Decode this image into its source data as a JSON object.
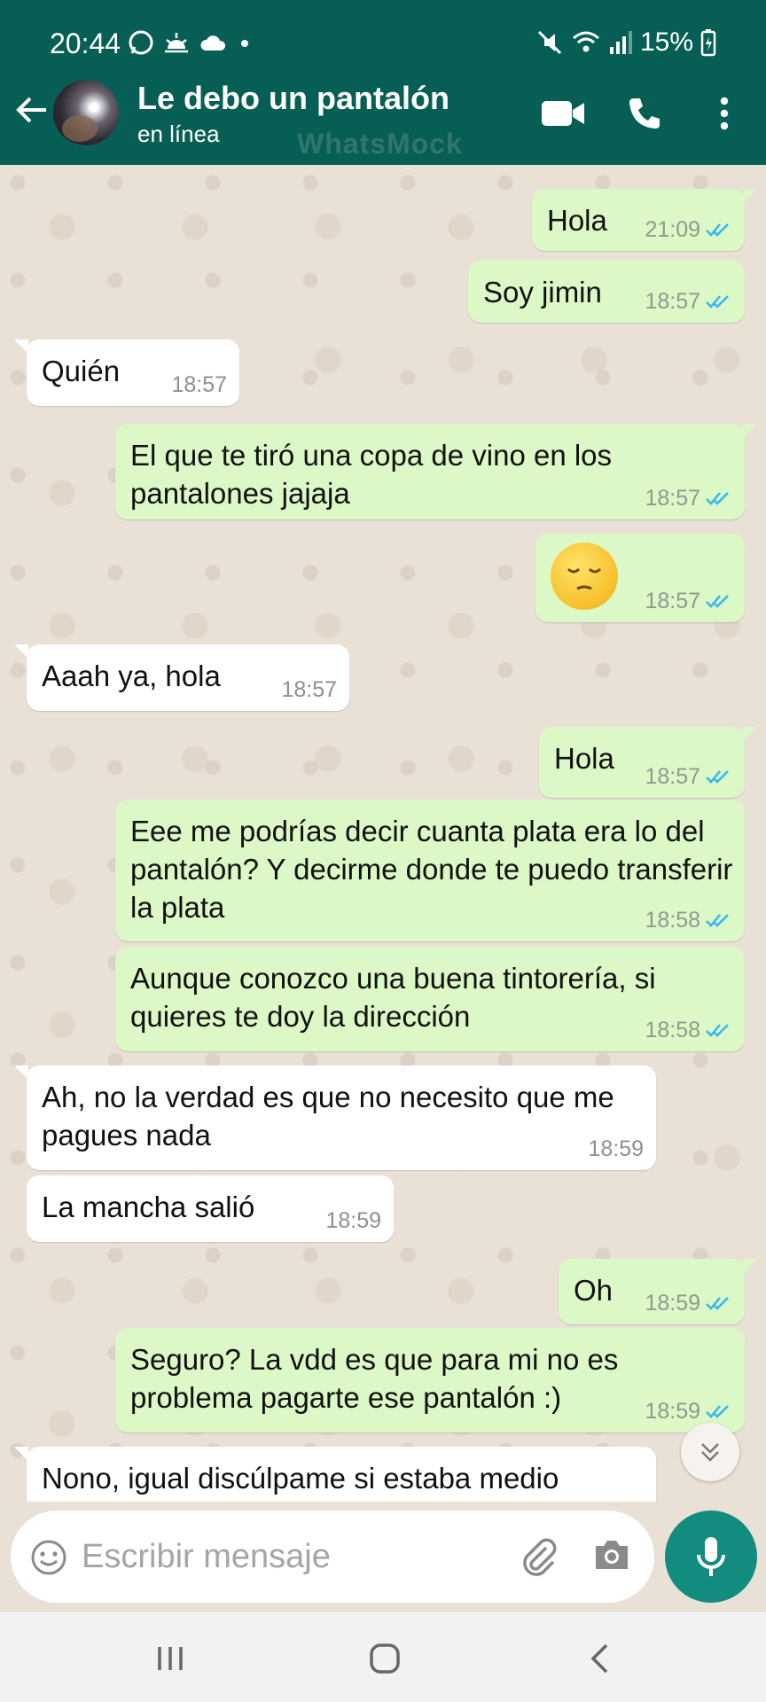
{
  "status_bar": {
    "time": "20:44",
    "battery": "15%",
    "icons": [
      "whatsapp-icon",
      "sunrise-icon",
      "cloud-icon",
      "dot-icon",
      "mute-icon",
      "wifi-icon",
      "signal-icon",
      "battery-charging-icon"
    ]
  },
  "header": {
    "contact_name": "Le debo un pantalón",
    "status": "en línea",
    "watermark": "WhatsMock",
    "icons": [
      "back-arrow-icon",
      "video-call-icon",
      "phone-icon",
      "more-vert-icon"
    ]
  },
  "messages": [
    {
      "dir": "out",
      "text": "Hola",
      "time": "21:09",
      "read": true
    },
    {
      "dir": "out",
      "text": "Soy jimin",
      "time": "18:57",
      "read": true
    },
    {
      "dir": "in",
      "text": "Quién",
      "time": "18:57"
    },
    {
      "dir": "out",
      "text": "El que te tiró una copa de vino en los pantalones jajaja",
      "time": "18:57",
      "read": true
    },
    {
      "dir": "out",
      "text": "",
      "emoji": "pensive-face",
      "time": "18:57",
      "read": true
    },
    {
      "dir": "in",
      "text": "Aaah ya, hola",
      "time": "18:57"
    },
    {
      "dir": "out",
      "text": "Hola",
      "time": "18:57",
      "read": true
    },
    {
      "dir": "out",
      "text": "Eee me podrías decir cuanta plata era lo del pantalón? Y decirme donde te puedo transferir la plata",
      "time": "18:58",
      "read": true
    },
    {
      "dir": "out",
      "text": "Aunque conozco una buena tintorería, si quieres te doy la dirección",
      "time": "18:58",
      "read": true
    },
    {
      "dir": "in",
      "text": "Ah, no la verdad es que no necesito que me pagues nada",
      "time": "18:59"
    },
    {
      "dir": "in",
      "text": "La mancha salió",
      "time": "18:59"
    },
    {
      "dir": "out",
      "text": "Oh",
      "time": "18:59",
      "read": true
    },
    {
      "dir": "out",
      "text": "Seguro? La vdd es que para mi no es problema pagarte ese pantalón :)",
      "time": "18:59",
      "read": true
    },
    {
      "dir": "in",
      "text": "Nono, igual discúlpame si estaba medio",
      "time": ""
    }
  ],
  "composer": {
    "placeholder": "Escribir mensaje",
    "icons": [
      "emoji-icon",
      "attach-icon",
      "camera-icon",
      "mic-icon"
    ]
  },
  "colors": {
    "header": "#075e54",
    "outgoing_bubble": "#dcf8c6",
    "incoming_bubble": "#ffffff",
    "read_ticks": "#34b7f1",
    "mic_button": "#128c7e",
    "chat_bg": "#e9e0d6"
  },
  "nav": [
    "recent-apps-icon",
    "home-icon",
    "back-icon"
  ]
}
